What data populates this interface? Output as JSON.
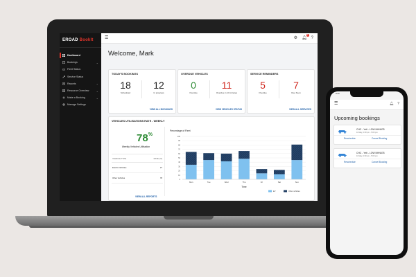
{
  "sidebar": {
    "brand": "EROAD",
    "app": "BookIt",
    "items": [
      {
        "label": "Dashboard",
        "icon": "dashboard-icon",
        "active": true
      },
      {
        "label": "Bookings",
        "icon": "calendar-icon",
        "chevron": true
      },
      {
        "label": "Fleet Status",
        "icon": "car-icon"
      },
      {
        "label": "Service Status",
        "icon": "wrench-icon"
      },
      {
        "label": "Reports",
        "icon": "report-icon",
        "chevron": true
      },
      {
        "label": "Resource Overview",
        "icon": "grid-icon",
        "chevron": true
      },
      {
        "label": "Make a Booking",
        "icon": "plus-icon",
        "chevron": true
      },
      {
        "label": "Manage Settings",
        "icon": "gear-icon"
      }
    ]
  },
  "topbar": {
    "notification_count": "2"
  },
  "welcome": "Welcome, Mark",
  "bookings": {
    "title": "TODAY'S BOOKINGS",
    "stats": [
      {
        "value": "18",
        "label": "Scheduled",
        "color": "#222222"
      },
      {
        "value": "12",
        "label": "In progress",
        "color": "#222222"
      }
    ],
    "link": "VIEW ALL BOOKINGS"
  },
  "overdue": {
    "title": "OVERDUE VEHICLES",
    "stats": [
      {
        "value": "0",
        "label": "Overdue",
        "color": "#2e8b35"
      },
      {
        "value": "11",
        "label": "Overdue in 10 minutes",
        "color": "#d0281f"
      }
    ],
    "link": "VIEW VEHICLES STATUS"
  },
  "service": {
    "title": "SERVICE REMINDERS",
    "stats": [
      {
        "value": "5",
        "label": "Overdue",
        "color": "#d0281f"
      },
      {
        "value": "7",
        "label": "Due Soon",
        "color": "#d0281f"
      }
    ],
    "link": "VIEW ALL SERVICES"
  },
  "utilisation": {
    "title": "VEHICLES UTILISATIONS RATE - WEEKLY",
    "percent": "78",
    "percent_sign": "%",
    "label": "Weekly Vehicles Utilisation",
    "table_headers": [
      "VEHICLE TYPE",
      "RATE (%)"
    ],
    "rows": [
      {
        "type": "Electric Vehicles",
        "rate": "27"
      },
      {
        "type": "Other Vehicles",
        "rate": "78"
      }
    ],
    "link": "VIEW ALL REPORTS"
  },
  "chart_data": {
    "type": "bar",
    "stacked": true,
    "ylabel": "Percentage of Fleet",
    "xlabel": "Time",
    "ylim": [
      0,
      100
    ],
    "grid": true,
    "legend_position": "bottom-right",
    "categories": [
      "Mon",
      "Tue",
      "Wed",
      "Thu",
      "Fri",
      "Sat",
      "Sun"
    ],
    "series": [
      {
        "name": "EV",
        "color": "#7fc1ef",
        "values": [
          34,
          45,
          42,
          48,
          14,
          12,
          45
        ]
      },
      {
        "name": "Other vehicles",
        "color": "#1f3b5e",
        "values": [
          30,
          16,
          18,
          18,
          10,
          10,
          36
        ]
      }
    ]
  },
  "phone": {
    "time": "9:41",
    "title": "Upcoming bookings",
    "bookings": [
      {
        "name": "CHC - Yeti - LOW NHN678",
        "date": "11 May, 2:00 pm - 5:00 pm",
        "reschedule": "Reschedule",
        "cancel": "Cancel Booking"
      },
      {
        "name": "CHC - Yeti - LOW NHN678",
        "date": "11 May, 2:00 pm - 5:00 pm",
        "reschedule": "Reschedule",
        "cancel": "Cancel Booking"
      }
    ]
  },
  "colors": {
    "accent": "#e0342a",
    "link": "#1e5fa8"
  }
}
